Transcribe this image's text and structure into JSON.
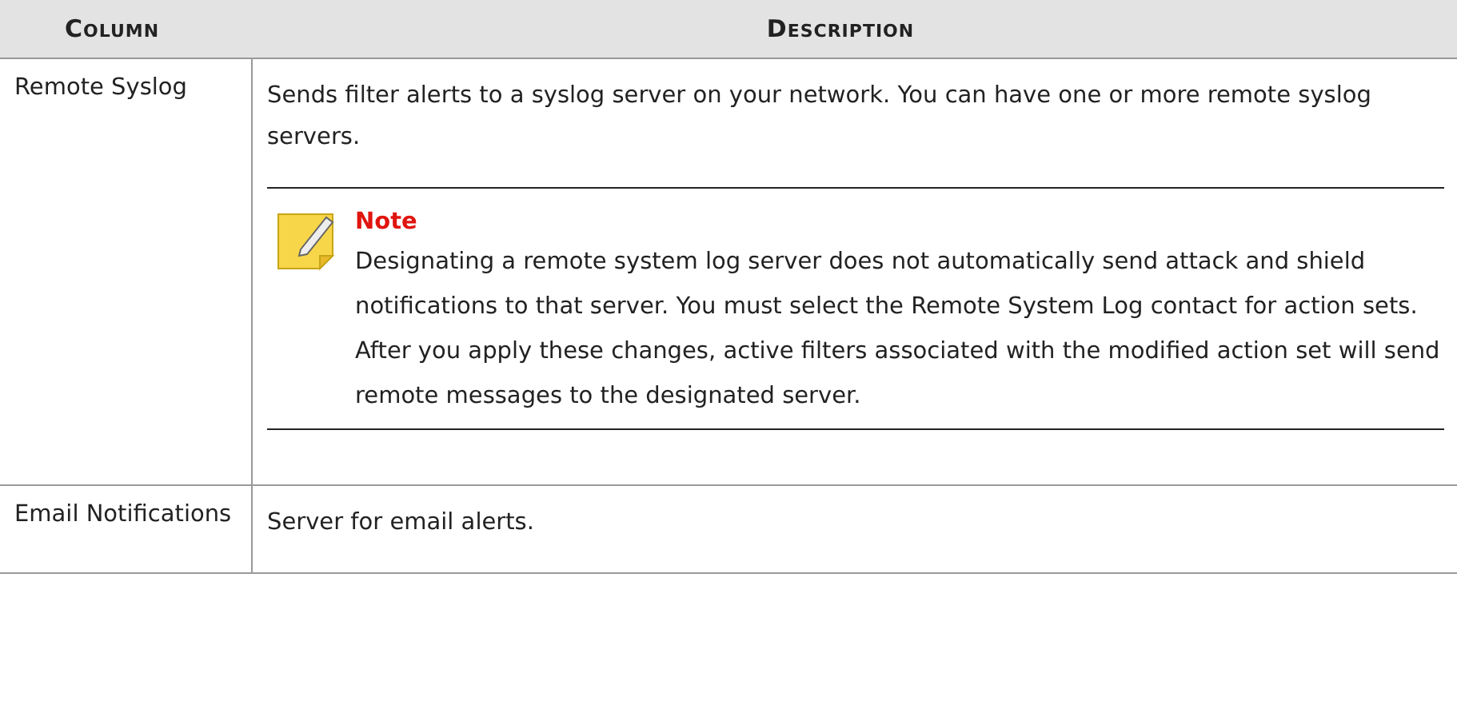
{
  "table": {
    "columns": [
      "Column",
      "Description"
    ],
    "rows": [
      {
        "column": "Remote Syslog",
        "description": "Sends filter alerts to a syslog server on your network. You can have one or more remote syslog servers.",
        "note": {
          "title": "Note",
          "text": "Designating a remote system log server does not automatically send attack and shield notifications to that server. You must select the Remote System Log contact for action sets. After you apply these changes, active filters associated with the modified action set will send remote messages to the designated server."
        }
      },
      {
        "column": "Email Notifications",
        "description": "Server for email alerts."
      }
    ]
  }
}
